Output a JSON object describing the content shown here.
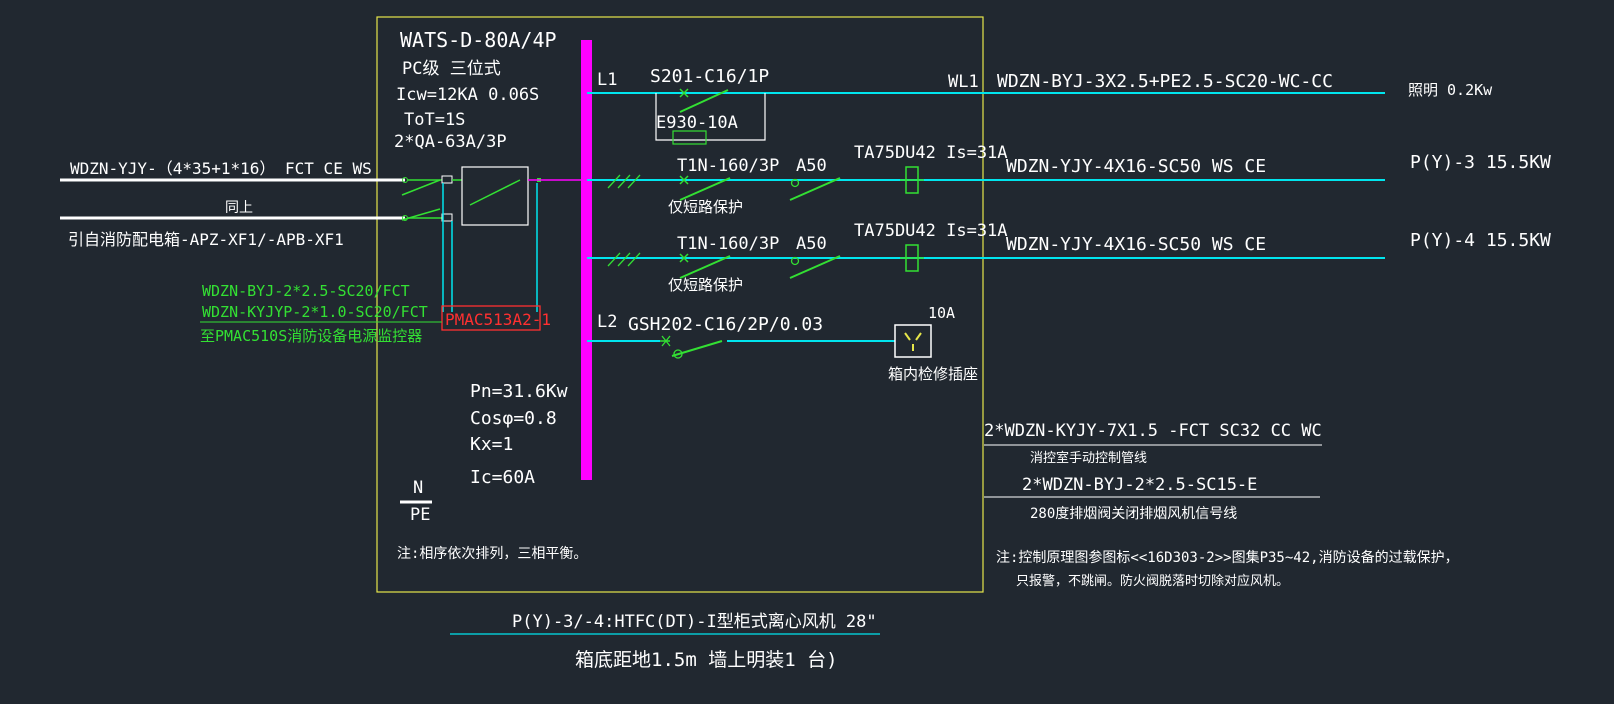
{
  "panel": {
    "model": "WATS-D-80A/4P",
    "class": "PC级 三位式",
    "icw": "Icw=12KA 0.06S",
    "tot": "ToT=1S",
    "qa": "2*QA-63A/3P",
    "monitor_module": "PMAC513A2-1"
  },
  "incoming": {
    "cable": "WDZN-YJY-（4*35+1*16） FCT CE WS",
    "same": "同上",
    "source": "引自消防配电箱-APZ-XF1/-APB-XF1"
  },
  "monitor": {
    "cable1": "WDZN-BYJ-2*2.5-SC20/FCT",
    "cable2": "WDZN-KYJYP-2*1.0-SC20/FCT",
    "target": "至PMAC510S消防设备电源监控器"
  },
  "bus": {
    "l1": "L1",
    "l2": "L2"
  },
  "circuits": [
    {
      "breaker": "S201-C16/1P",
      "accessory": "E930-10A",
      "label": "WL1",
      "cable": "WDZN-BYJ-3X2.5+PE2.5-SC20-WC-CC",
      "load": "照明 0.2Kw"
    },
    {
      "breaker": "T1N-160/3P",
      "protection": "仅短路保护",
      "contactor": "A50",
      "relay": "TA75DU42 Is=31A",
      "cable": "WDZN-YJY-4X16-SC50 WS CE",
      "load": "P(Y)-3  15.5KW"
    },
    {
      "breaker": "T1N-160/3P",
      "protection": "仅短路保护",
      "contactor": "A50",
      "relay": "TA75DU42 Is=31A",
      "cable": "WDZN-YJY-4X16-SC50 WS CE",
      "load": "P(Y)-4  15.5KW"
    },
    {
      "breaker": "GSH202-C16/2P/0.03",
      "socket_rating": "10A",
      "socket_label": "箱内检修插座"
    }
  ],
  "params": {
    "pn": "Pn=31.6Kw",
    "cos": "Cosφ=0.8",
    "kx": "Kx=1",
    "ic": "Ic=60A"
  },
  "grounding": {
    "n": "N",
    "pe": "PE"
  },
  "note_left": "注:相序依次排列，三相平衡。",
  "control": {
    "cable1": "2*WDZN-KYJY-7X1.5 -FCT SC32 CC WC",
    "desc1": "消控室手动控制管线",
    "cable2": "2*WDZN-BYJ-2*2.5-SC15-E",
    "desc2": "280度排烟阀关闭排烟风机信号线"
  },
  "note_right": {
    "line1": "注:控制原理图参图标<<16D303-2>>图集P35~42,消防设备的过载保护，",
    "line2": "只报警，不跳闸。防火阀脱落时切除对应风机。"
  },
  "footer": {
    "line1": "P(Y)-3/-4:HTFC(DT)-I型柜式离心风机 28\"",
    "line2": "箱底距地1.5m 墙上明装1 台)"
  },
  "colors": {
    "background": "#212830",
    "cyan_line": "#00e5ee",
    "busbar": "#ff00ff",
    "green": "#33e033",
    "frame": "#e6e64a",
    "red_box": "#ff3030"
  }
}
